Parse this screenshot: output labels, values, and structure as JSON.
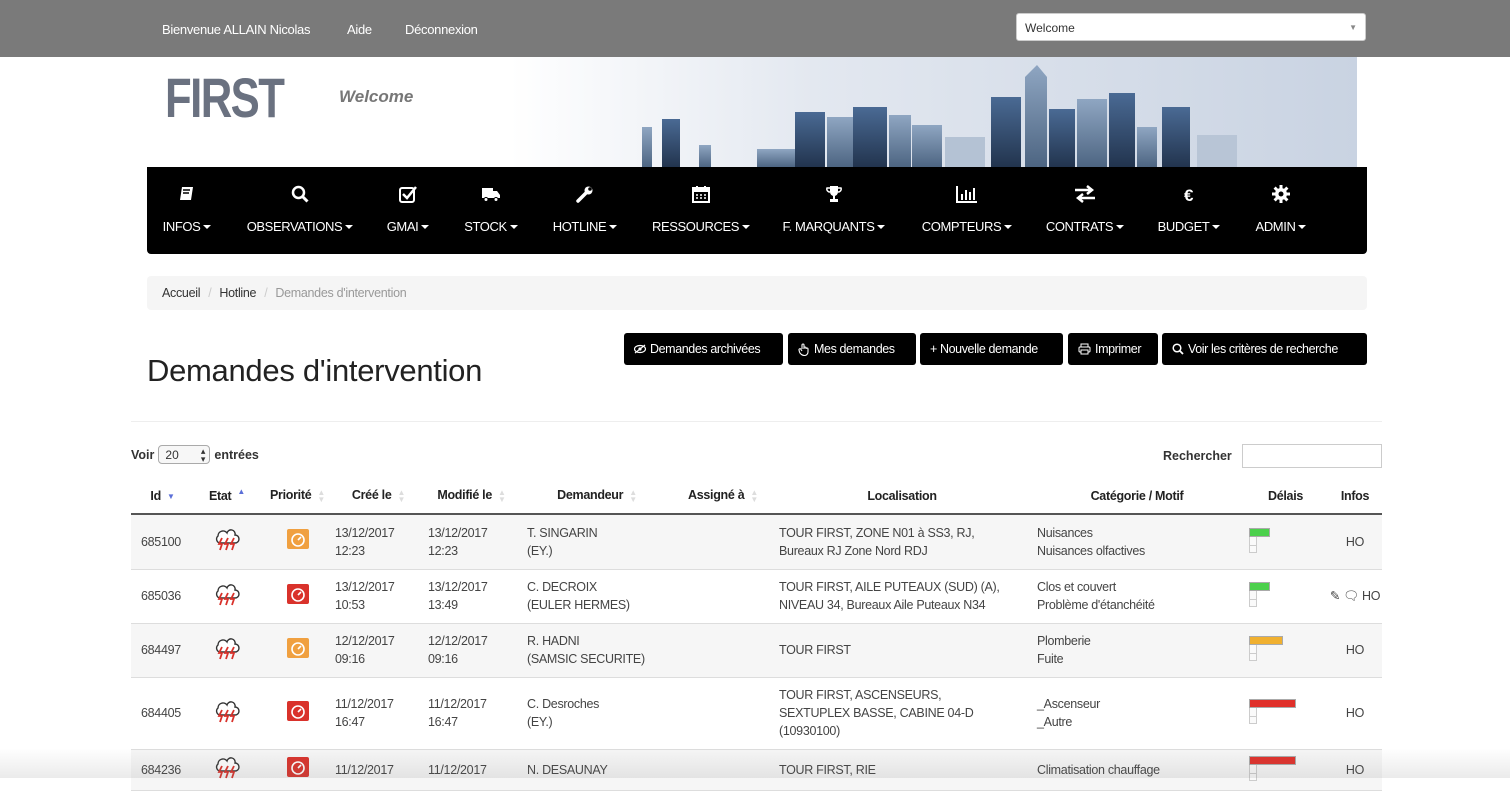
{
  "topbar": {
    "welcome_user": "Bienvenue ALLAIN Nicolas",
    "help": "Aide",
    "logout": "Déconnexion",
    "site_select": "Welcome"
  },
  "banner": {
    "logo": "FIRST",
    "subtitle": "Welcome"
  },
  "nav": [
    {
      "label": "INFOS",
      "icon": "book-icon"
    },
    {
      "label": "OBSERVATIONS",
      "icon": "search-icon"
    },
    {
      "label": "GMAI",
      "icon": "checkbox-icon"
    },
    {
      "label": "STOCK",
      "icon": "truck-icon"
    },
    {
      "label": "HOTLINE",
      "icon": "wrench-icon"
    },
    {
      "label": "RESSOURCES",
      "icon": "calendar-icon"
    },
    {
      "label": "F. MARQUANTS",
      "icon": "trophy-icon"
    },
    {
      "label": "COMPTEURS",
      "icon": "bar-chart-icon"
    },
    {
      "label": "CONTRATS",
      "icon": "transfer-icon"
    },
    {
      "label": "BUDGET",
      "icon": "euro-icon"
    },
    {
      "label": "ADMIN",
      "icon": "gear-icon"
    }
  ],
  "breadcrumb": [
    "Accueil",
    "Hotline",
    "Demandes d'intervention"
  ],
  "page_title": "Demandes d'intervention",
  "actions": {
    "archived": "Demandes archivées",
    "mine": "Mes demandes",
    "new": "+ Nouvelle demande",
    "print": "Imprimer",
    "criteria": "Voir les critères de recherche"
  },
  "table_controls": {
    "show_prefix": "Voir",
    "page_length": "20",
    "show_suffix": "entrées",
    "search_label": "Rechercher"
  },
  "columns": [
    "Id",
    "Etat",
    "Priorité",
    "Créé le",
    "Modifié le",
    "Demandeur",
    "Assigné à",
    "Localisation",
    "Catégorie / Motif",
    "Délais",
    "Infos"
  ],
  "rows": [
    {
      "id": "685100",
      "priority": "orange",
      "created": [
        "13/12/2017",
        "12:23"
      ],
      "modified": [
        "13/12/2017",
        "12:23"
      ],
      "requester": [
        "T. SINGARIN",
        "(EY.)"
      ],
      "assigned": "",
      "location": [
        "TOUR FIRST, ZONE N01 à SS3, RJ,",
        "Bureaux RJ Zone Nord RDJ"
      ],
      "category": [
        "Nuisances",
        "Nuisances olfactives"
      ],
      "delay_color": "#4cd04c",
      "delay_level": 0.4,
      "infos": "HO"
    },
    {
      "id": "685036",
      "priority": "red",
      "created": [
        "13/12/2017",
        "10:53"
      ],
      "modified": [
        "13/12/2017",
        "13:49"
      ],
      "requester": [
        "C. DECROIX",
        "(EULER HERMES)"
      ],
      "assigned": "",
      "location": [
        "TOUR FIRST, AILE PUTEAUX (SUD) (A),",
        "NIVEAU 34, Bureaux Aile Puteaux N34"
      ],
      "category": [
        "Clos et couvert",
        "Problème d'étanchéité"
      ],
      "delay_color": "#4cd04c",
      "delay_level": 0.4,
      "infos": "✎ 🗨 HO"
    },
    {
      "id": "684497",
      "priority": "orange",
      "created": [
        "12/12/2017",
        "09:16"
      ],
      "modified": [
        "12/12/2017",
        "09:16"
      ],
      "requester": [
        "R. HADNI",
        "(SAMSIC SECURITE)"
      ],
      "assigned": "",
      "location": [
        "TOUR FIRST"
      ],
      "category": [
        "Plomberie",
        "Fuite"
      ],
      "delay_color": "#f0b030",
      "delay_level": 0.65,
      "infos": "HO"
    },
    {
      "id": "684405",
      "priority": "red",
      "created": [
        "11/12/2017",
        "16:47"
      ],
      "modified": [
        "11/12/2017",
        "16:47"
      ],
      "requester": [
        "C. Desroches",
        "(EY.)"
      ],
      "assigned": "",
      "location": [
        "TOUR FIRST, ASCENSEURS,",
        "SEXTUPLEX BASSE, CABINE 04-D",
        "(10930100)"
      ],
      "category": [
        "_Ascenseur",
        "_Autre"
      ],
      "delay_color": "#e0302a",
      "delay_level": 0.9,
      "infos": "HO"
    },
    {
      "id": "684236",
      "priority": "red",
      "created": [
        "11/12/2017",
        ""
      ],
      "modified": [
        "11/12/2017",
        ""
      ],
      "requester": [
        "N. DESAUNAY",
        ""
      ],
      "assigned": "",
      "location": [
        "TOUR FIRST, RIE"
      ],
      "category": [
        "Climatisation chauffage",
        ""
      ],
      "delay_color": "#e0302a",
      "delay_level": 0.9,
      "infos": "HO"
    }
  ],
  "colors": {
    "topbar": "#7a7a7a",
    "navbar": "#000000",
    "accent_sort": "#5b6fd8"
  }
}
